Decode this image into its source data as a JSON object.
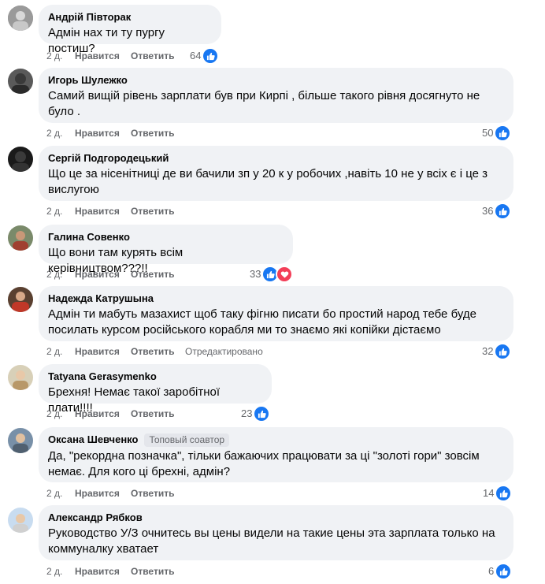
{
  "comments": [
    {
      "author": "Андрій Півторак",
      "text_lines": [
        "Адмін нах ти ту пургу постиш?"
      ],
      "time": "2 д.",
      "like": "Нравится",
      "reply": "Ответить",
      "count": "64",
      "avatar_color": "#8a8a8a"
    },
    {
      "author": "Игорь Шулежко",
      "text_lines": [
        "Самий вищій рівень зарплати був при Кирпі , більше такого рівня досягнуто не",
        "було ."
      ],
      "time": "2 д.",
      "like": "Нравится",
      "reply": "Ответить",
      "count": "50",
      "avatar_color": "#4a4a4a"
    },
    {
      "author": "Сергій Подгородецький",
      "text_lines": [
        "Що це за нісенітниці де ви бачили зп у 20 к у робочих ,навіть 10 не у всіх є і це з",
        "вислугою"
      ],
      "time": "2 д.",
      "like": "Нравится",
      "reply": "Ответить",
      "count": "36",
      "avatar_color": "#1a1a1a"
    },
    {
      "author": "Галина Совенко",
      "text_lines": [
        "Що вони там курять всім керівництвом???!!"
      ],
      "time": "2 д.",
      "like": "Нравится",
      "reply": "Ответить",
      "count": "33",
      "avatar_color": "#6a7a5a"
    },
    {
      "author": "Надежда Катрушына",
      "text_lines": [
        "Адмін ти мабуть мазахист щоб таку фігню писати бо простий народ тебе буде",
        "посилать курсом російського корабля ми то знаємо які копійки дістаємо"
      ],
      "time": "2 д.",
      "like": "Нравится",
      "reply": "Ответить",
      "edited": "Отредактировано",
      "count": "32",
      "avatar_color": "#b04030"
    },
    {
      "author": "Tatyana Gerasymenko",
      "text_lines": [
        "Брехня! Немає такої заробітної плати!!!!"
      ],
      "time": "2 д.",
      "like": "Нравится",
      "reply": "Ответить",
      "count": "23",
      "avatar_color": "#c8b890"
    },
    {
      "author": "Оксана Шевченко",
      "badge": "Топовый соавтор",
      "text_lines": [
        "Да, \"рекордна позначка\", тільки бажаючих працювати за ці \"золоті гори\" зовсім",
        "немає. Для кого ці брехні, адмін?"
      ],
      "time": "2 д.",
      "like": "Нравится",
      "reply": "Ответить",
      "count": "14",
      "avatar_color": "#607890"
    },
    {
      "author": "Александр Рябков",
      "text_lines": [
        "Руководство У/З очнитесь вы цены видели на такие цены эта зарплата только на",
        "коммуналку хватает"
      ],
      "time": "2 д.",
      "like": "Нравится",
      "reply": "Ответить",
      "count": "6",
      "avatar_color": "#9ab8d8"
    }
  ]
}
